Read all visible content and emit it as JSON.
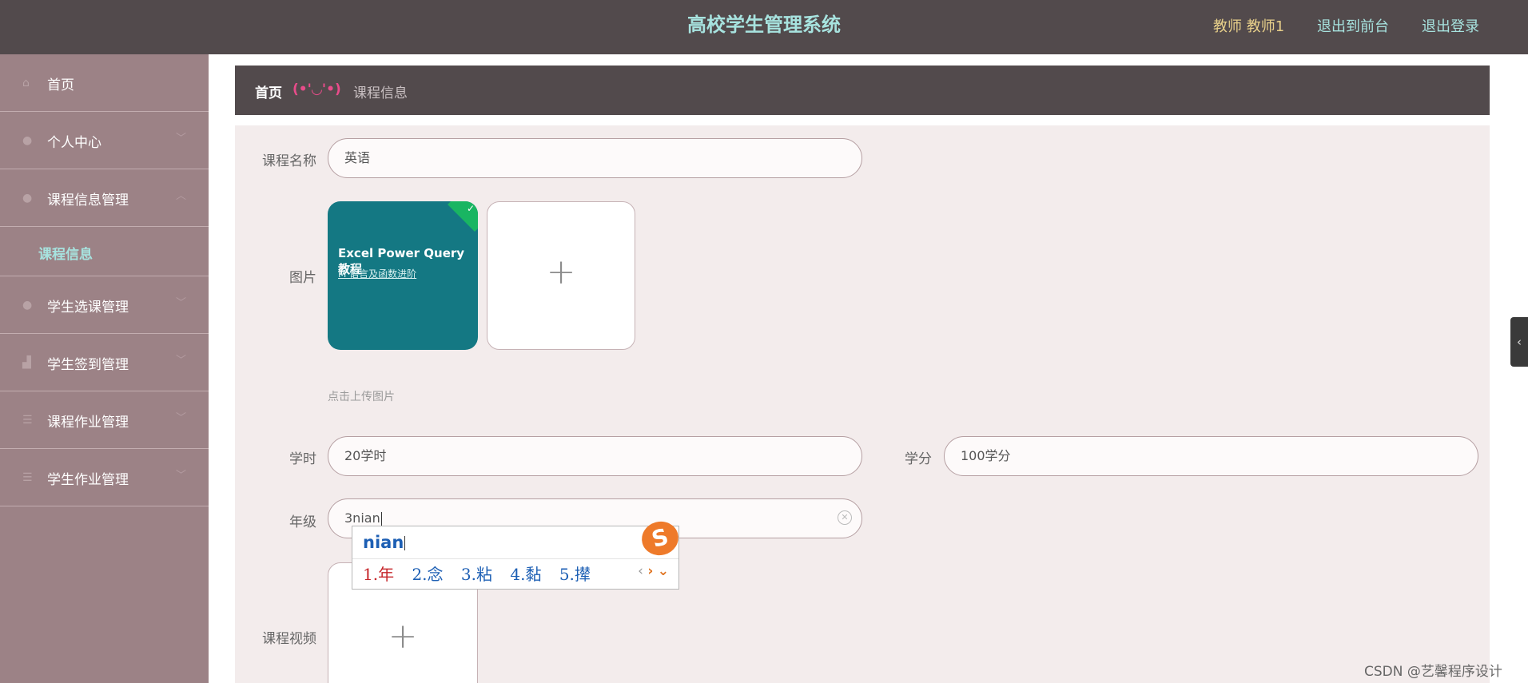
{
  "header": {
    "title": "高校学生管理系统",
    "user": "教师 教师1",
    "front_link": "退出到前台",
    "logout_link": "退出登录"
  },
  "sidebar": {
    "items": [
      {
        "label": "首页",
        "icon": "home-icon"
      },
      {
        "label": "个人中心",
        "icon": "user-icon"
      },
      {
        "label": "课程信息管理",
        "icon": "user-icon",
        "expanded": true,
        "children": [
          {
            "label": "课程信息",
            "active": true
          }
        ]
      },
      {
        "label": "学生选课管理",
        "icon": "user-icon"
      },
      {
        "label": "学生签到管理",
        "icon": "chart-icon"
      },
      {
        "label": "课程作业管理",
        "icon": "list-icon"
      },
      {
        "label": "学生作业管理",
        "icon": "list-icon"
      }
    ]
  },
  "breadcrumb": {
    "home": "首页",
    "face": "(•'◡'•)",
    "current": "课程信息"
  },
  "form": {
    "course_name_label": "课程名称",
    "course_name_value": "英语",
    "image_label": "图片",
    "image_title": "Excel Power Query 教程",
    "image_subtitle": "M 语言及函数进阶",
    "upload_hint": "点击上传图片",
    "hours_label": "学时",
    "hours_value": "20学时",
    "credit_label": "学分",
    "credit_value": "100学分",
    "grade_label": "年级",
    "grade_value": "3nian",
    "video_label": "课程视频"
  },
  "ime": {
    "pinyin": "nian",
    "candidates": [
      "1.年",
      "2.念",
      "3.粘",
      "4.黏",
      "5.撵"
    ]
  },
  "watermark": "CSDN @艺馨程序设计",
  "colors": {
    "topbar": "#524a4c",
    "sidebar": "#9c8286",
    "accent": "#a7e3df",
    "user": "#e8d08a"
  }
}
